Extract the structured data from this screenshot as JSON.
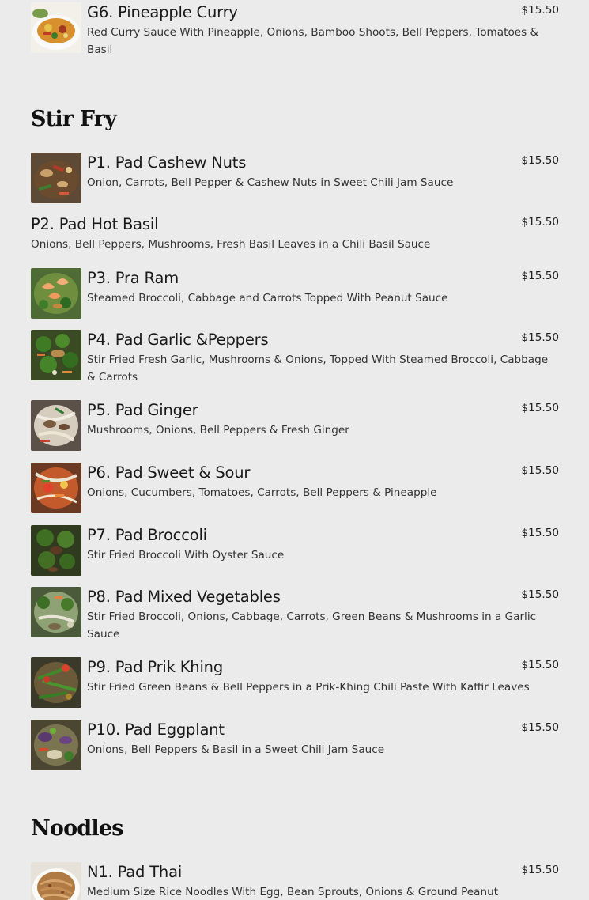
{
  "items": {
    "g6": {
      "name": "G6. Pineapple Curry",
      "desc": "Red Curry Sauce With Pineapple, Onions, Bamboo Shoots, Bell Peppers, Tomatoes & Basil",
      "price": "$15.50",
      "photo": "pineapple-curry-photo"
    },
    "p1": {
      "name": "P1. Pad Cashew Nuts",
      "desc": "Onion, Carrots, Bell Pepper & Cashew Nuts in Sweet Chili Jam Sauce",
      "price": "$15.50",
      "photo": "pad-cashew-nuts-photo"
    },
    "p2": {
      "name": "P2. Pad Hot Basil",
      "desc": "Onions, Bell Peppers, Mushrooms, Fresh Basil Leaves in a Chili Basil Sauce",
      "price": "$15.50"
    },
    "p3": {
      "name": "P3. Pra Ram",
      "desc": "Steamed Broccoli, Cabbage and Carrots Topped With Peanut Sauce",
      "price": "$15.50",
      "photo": "pra-ram-photo"
    },
    "p4": {
      "name": "P4. Pad Garlic &Peppers",
      "desc": "Stir Fried Fresh Garlic, Mushrooms & Onions, Topped With Steamed Broccoli, Cabbage & Carrots",
      "price": "$15.50",
      "photo": "pad-garlic-peppers-photo"
    },
    "p5": {
      "name": "P5. Pad Ginger",
      "desc": "Mushrooms, Onions, Bell Peppers & Fresh Ginger",
      "price": "$15.50",
      "photo": "pad-ginger-photo"
    },
    "p6": {
      "name": "P6. Pad Sweet & Sour",
      "desc": "Onions, Cucumbers, Tomatoes, Carrots, Bell Peppers & Pineapple",
      "price": "$15.50",
      "photo": "pad-sweet-sour-photo"
    },
    "p7": {
      "name": "P7. Pad Broccoli",
      "desc": "Stir Fried Broccoli With Oyster Sauce",
      "price": "$15.50",
      "photo": "pad-broccoli-photo"
    },
    "p8": {
      "name": "P8. Pad Mixed Vegetables",
      "desc": "Stir Fried Broccoli, Onions, Cabbage, Carrots, Green Beans & Mushrooms in a Garlic Sauce",
      "price": "$15.50",
      "photo": "pad-mixed-vegetables-photo"
    },
    "p9": {
      "name": "P9. Pad Prik Khing",
      "desc": "Stir Fried Green Beans & Bell Peppers in a Prik-Khing Chili Paste With Kaffir Leaves",
      "price": "$15.50",
      "photo": "pad-prik-khing-photo"
    },
    "p10": {
      "name": "P10. Pad Eggplant",
      "desc": "Onions, Bell Peppers & Basil in a Sweet Chili Jam Sauce",
      "price": "$15.50",
      "photo": "pad-eggplant-photo"
    },
    "n1": {
      "name": "N1. Pad Thai",
      "desc": "Medium Size Rice Noodles With Egg, Bean Sprouts, Onions & Ground Peanut",
      "price": "$15.50",
      "photo": "pad-thai-photo"
    }
  },
  "sections": {
    "stir_fry": "Stir Fry",
    "noodles": "Noodles"
  },
  "colors": {
    "background": "#ebebeb",
    "text": "#1a1a1a"
  }
}
